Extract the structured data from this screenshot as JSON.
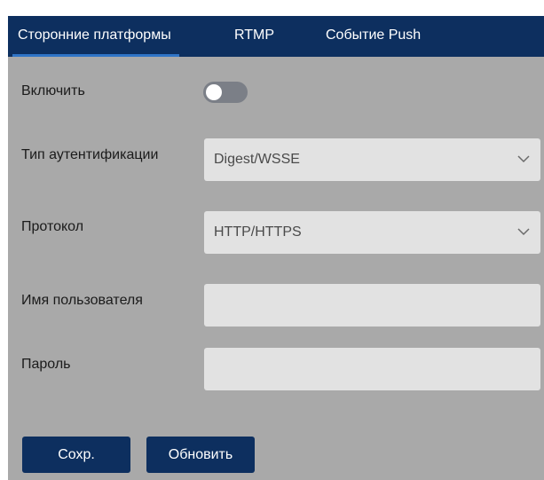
{
  "tabs": [
    {
      "label": "Сторонние платформы",
      "active": true
    },
    {
      "label": "RTMP",
      "active": false
    },
    {
      "label": "Событие Push",
      "active": false
    }
  ],
  "form": {
    "enable": {
      "label": "Включить",
      "on": false
    },
    "auth_type": {
      "label": "Тип аутентификации",
      "value": "Digest/WSSE",
      "icon": "chevron-down-icon"
    },
    "protocol": {
      "label": "Протокол",
      "value": "HTTP/HTTPS",
      "icon": "chevron-down-icon"
    },
    "username": {
      "label": "Имя пользователя",
      "value": ""
    },
    "password": {
      "label": "Пароль",
      "value": ""
    }
  },
  "buttons": {
    "save": "Сохр.",
    "refresh": "Обновить"
  },
  "colors": {
    "header_bg": "#0d2f5f",
    "active_tab_underline": "#2f74c7",
    "panel_bg": "#a9a9a9",
    "field_bg": "#e2e2e2",
    "button_bg": "#0d2f5f"
  }
}
